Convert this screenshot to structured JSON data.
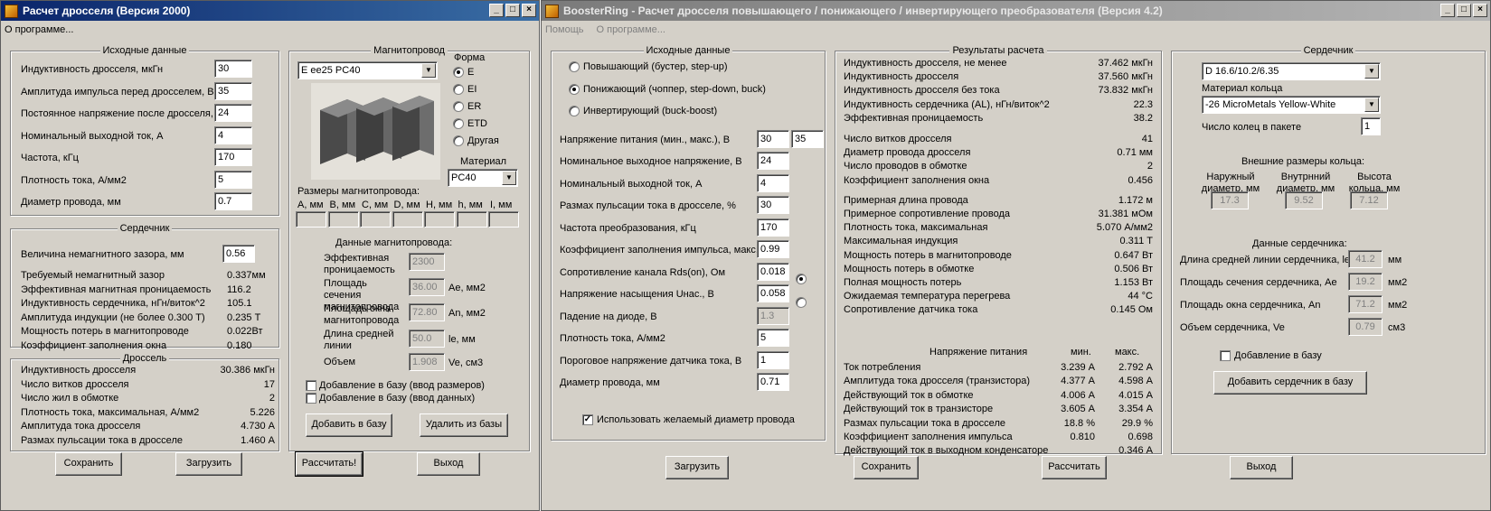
{
  "w1": {
    "title": "Расчет дросселя (Версия 2000)",
    "menu": "О программе...",
    "src": {
      "title": "Исходные данные",
      "rows": [
        {
          "label": "Индуктивность  дросселя, мкГн",
          "value": "30"
        },
        {
          "label": "Амплитуда импульса перед дросселем, В",
          "value": "35"
        },
        {
          "label": "Постоянное напряжение после дросселя, В",
          "value": "24"
        },
        {
          "label": "Номинальный выходной ток, А",
          "value": "4"
        },
        {
          "label": "Частота, кГц",
          "value": "170"
        },
        {
          "label": "Плотность тока, А/мм2",
          "value": "5"
        },
        {
          "label": "Диаметр провода, мм",
          "value": "0.7"
        }
      ]
    },
    "core": {
      "title": "Сердечник",
      "gap_label": "Величина немагнитного зазора, мм",
      "gap_value": "0.56",
      "rows": [
        {
          "label": "Требуемый немагнитный зазор",
          "value": "0.337мм"
        },
        {
          "label": "Эффективная магнитная проницаемость",
          "value": "116.2"
        },
        {
          "label": "Индуктивность сердечника, нГн/виток^2",
          "value": "105.1"
        },
        {
          "label": "Амплитуда индукции    (не более 0.300 Т)",
          "value": "0.235 Т"
        },
        {
          "label": "Мощность потерь в магнитопроводе",
          "value": "0.022Вт"
        },
        {
          "label": "Коэффициент заполнения окна",
          "value": "0.180"
        }
      ]
    },
    "choke": {
      "title": "Дроссель",
      "rows": [
        {
          "label": "Индуктивность дросселя",
          "value": "30.386 мкГн"
        },
        {
          "label": "Число витков дросселя",
          "value": "17"
        },
        {
          "label": "Число жил в обмотке",
          "value": "2"
        },
        {
          "label": "Плотность тока, максимальная, А/мм2",
          "value": "5.226"
        },
        {
          "label": "Амплитуда тока дросселя",
          "value": "4.730 А"
        },
        {
          "label": "Размах пульсации тока в дросселе",
          "value": "1.460 А"
        }
      ]
    },
    "mag": {
      "title": "Магнитопровод",
      "core_select": "E ee25 PC40",
      "shape_title": "Форма",
      "shapes": [
        "E",
        "EI",
        "ER",
        "ETD",
        "Другая"
      ],
      "material_title": "Материал",
      "material_select": "PC40",
      "dims_title": "Размеры магнитопровода:",
      "dims": [
        "A, мм",
        "B, мм",
        "C, мм",
        "D, мм",
        "H, мм",
        "h, мм",
        "I, мм"
      ],
      "data_title": "Данные магнитопровода:",
      "perm_label": "Эффективная проницаемость",
      "perm_value": "2300",
      "ae_label": "Площадь сечения магнитопровода",
      "ae_value": "36.00",
      "ae_unit": "Ae, мм2",
      "an_label": "Площадь окна магнитопровода",
      "an_value": "72.80",
      "an_unit": "An, мм2",
      "le_label": "Длина средней линии",
      "le_value": "50.0",
      "le_unit": "le, мм",
      "ve_label": "Объем",
      "ve_value": "1.908",
      "ve_unit": "Ve, см3",
      "chk1": "Добавление в базу (ввод размеров)",
      "chk2": "Добавление в базу (ввод данных)",
      "add_btn": "Добавить в базу",
      "del_btn": "Удалить из базы"
    },
    "btns": {
      "save": "Сохранить",
      "load": "Загрузить",
      "calc": "Рассчитать!",
      "exit": "Выход"
    }
  },
  "w2": {
    "title": "BoosterRing - Расчет дросселя повышающего / понижающего / инвертирующего преобразователя (Версия 4.2)",
    "menu1": "Помощь",
    "menu2": "О программе...",
    "src": {
      "title": "Исходные данные",
      "modes": [
        "Повышающий (бустер, step-up)",
        "Понижающий (чоппер, step-down, buck)",
        "Инвертирующий (buck-boost)"
      ],
      "vin_label": "Напряжение питания (мин., макс.), В",
      "vin_min": "30",
      "vin_max": "35",
      "rows": [
        {
          "label": "Номинальное выходное напряжение, В",
          "value": "24"
        },
        {
          "label": "Номинальный выходной ток, А",
          "value": "4"
        },
        {
          "label": "Размах пульсации тока в дросселе, %",
          "value": "30"
        },
        {
          "label": "Частота преобразования, кГц",
          "value": "170"
        },
        {
          "label": "Коэффициент заполнения импульса, макс.",
          "value": "0.99"
        },
        {
          "label": "Сопротивление канала Rds(on), Ом",
          "value": "0.018"
        },
        {
          "label": "Напряжение насыщения Uнас., В",
          "value": "0.058"
        },
        {
          "label": "Падение на диоде, В",
          "value": "1.3"
        },
        {
          "label": "Плотность тока, А/мм2",
          "value": "5"
        },
        {
          "label": "Пороговое напряжение датчика тока, В",
          "value": "1"
        },
        {
          "label": "Диаметр провода, мм",
          "value": "0.71"
        }
      ],
      "use_wire": "Использовать желаемый диаметр провода"
    },
    "res": {
      "title": "Результаты расчета",
      "g1": [
        {
          "label": "Индуктивность дросселя, не менее",
          "value": "37.462 мкГн"
        },
        {
          "label": "Индуктивность дросселя",
          "value": "37.560 мкГн"
        },
        {
          "label": "Индуктивность дросселя без тока",
          "value": "73.832 мкГн"
        },
        {
          "label": "Индуктивность сердечника (AL), нГн/виток^2",
          "value": "22.3"
        },
        {
          "label": "Эффективная проницаемость",
          "value": "38.2"
        }
      ],
      "g2": [
        {
          "label": "Число витков дросселя",
          "value": "41"
        },
        {
          "label": "Диаметр провода дросселя",
          "value": "0.71 мм"
        },
        {
          "label": "Число проводов в обмотке",
          "value": "2"
        },
        {
          "label": "Коэффициент заполнения окна",
          "value": "0.456"
        }
      ],
      "g3": [
        {
          "label": "Примерная длина провода",
          "value": "1.172 м"
        },
        {
          "label": "Примерное сопротивление провода",
          "value": "31.381 мОм"
        },
        {
          "label": "Плотность тока, максимальная",
          "value": "5.070 А/мм2"
        },
        {
          "label": "Максимальная индукция",
          "value": "0.311 Т"
        },
        {
          "label": "Мощность потерь в магнитопроводе",
          "value": "0.647 Вт"
        },
        {
          "label": "Мощность потерь в обмотке",
          "value": "0.506 Вт"
        },
        {
          "label": "Полная мощность потерь",
          "value": "1.153 Вт"
        },
        {
          "label": "Ожидаемая температура перегрева",
          "value": "44 °C"
        },
        {
          "label": "Сопротивление датчика тока",
          "value": "0.145 Ом"
        }
      ],
      "supply_title": "Напряжение питания",
      "min_h": "мин.",
      "max_h": "макс.",
      "g4": [
        {
          "label": "Ток потребления",
          "min": "3.239 А",
          "max": "2.792 А"
        },
        {
          "label": "Амплитуда тока дросселя (транзистора)",
          "min": "4.377 А",
          "max": "4.598 А"
        },
        {
          "label": "Действующий ток в обмотке",
          "min": "4.006 А",
          "max": "4.015 А"
        },
        {
          "label": "Действующий ток в транзисторе",
          "min": "3.605 А",
          "max": "3.354 А"
        },
        {
          "label": "Размах пульсации тока в дросселе",
          "min": "18.8 %",
          "max": "29.9 %"
        },
        {
          "label": "Коэффициент заполнения импульса",
          "min": "0.810",
          "max": "0.698"
        },
        {
          "label": "Действующий ток в выходном конденсаторе",
          "min": "",
          "max": "0.346 А"
        }
      ]
    },
    "core": {
      "title": "Сердечник",
      "core_select": "D 16.6/10.2/6.35",
      "mat_label": "Материал кольца",
      "mat_select": "-26 MicroMetals Yellow-White",
      "rings_label": "Число колец в пакете",
      "rings_value": "1",
      "ext_title": "Внешние размеры кольца:",
      "od_label": "Наружный диаметр, мм",
      "od_value": "17.3",
      "id_label": "Внутрнний диаметр, мм",
      "id_value": "9.52",
      "h_label": "Высота кольца, мм",
      "h_value": "7.12",
      "data_title": "Данные сердечника:",
      "le_label": "Длина средней линии сердечника, le",
      "le_value": "41.2",
      "le_unit": "мм",
      "ae_label": "Площадь сечения сердечника, Ae",
      "ae_value": "19.2",
      "ae_unit": "мм2",
      "an_label": "Площадь окна сердечника, An",
      "an_value": "71.2",
      "an_unit": "мм2",
      "ve_label": "Объем сердечника, Ve",
      "ve_value": "0.79",
      "ve_unit": "см3",
      "add_chk": "Добавление в базу",
      "add_btn": "Добавить сердечник в базу"
    },
    "btns": {
      "load": "Загрузить",
      "save": "Сохранить",
      "calc": "Рассчитать",
      "exit": "Выход"
    }
  }
}
